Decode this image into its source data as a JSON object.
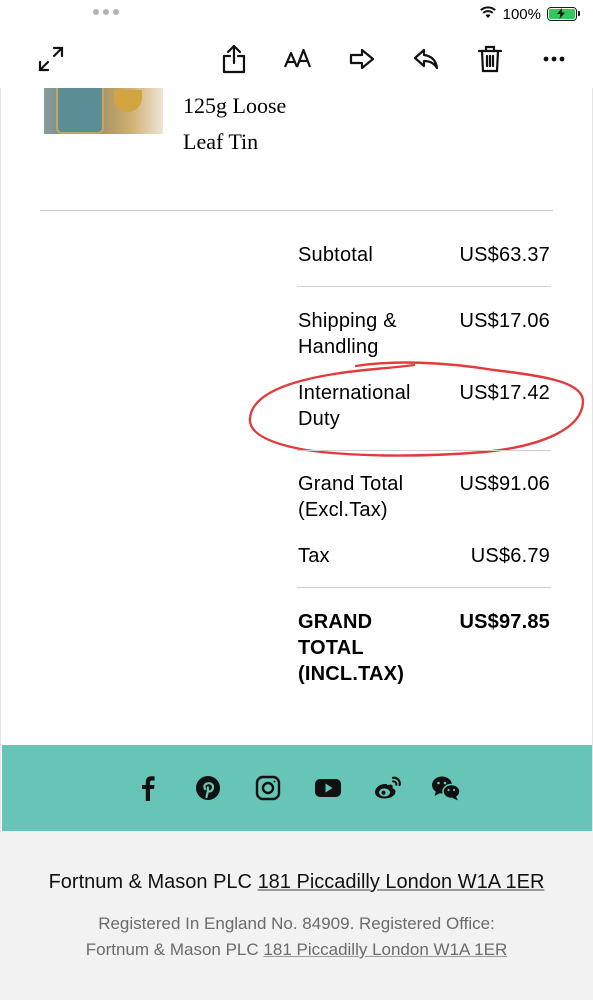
{
  "status_bar": {
    "battery_percent": "100%",
    "battery_color": "#35c759"
  },
  "toolbar": {
    "icons": [
      "expand-icon",
      "share-icon",
      "text-size-icon",
      "forward-icon",
      "reply-icon",
      "trash-icon",
      "more-icon"
    ]
  },
  "product": {
    "name_line1": "125g Loose",
    "name_line2": "Leaf Tin"
  },
  "totals": {
    "subtotal_label": "Subtotal",
    "subtotal_value": "US$63.37",
    "shipping_label": "Shipping &\nHandling",
    "shipping_value": "US$17.06",
    "duty_label": "International\nDuty",
    "duty_value": "US$17.42",
    "grand_excl_label": "Grand Total\n(Excl.Tax)",
    "grand_excl_value": "US$91.06",
    "tax_label": "Tax",
    "tax_value": "US$6.79",
    "grand_incl_label": "GRAND\nTOTAL\n(INCL.TAX)",
    "grand_incl_value": "US$97.85"
  },
  "annotation": {
    "color": "#e23b3b"
  },
  "social": {
    "background": "#67c5b7",
    "icons": [
      "facebook-icon",
      "pinterest-icon",
      "instagram-icon",
      "youtube-icon",
      "weibo-icon",
      "wechat-icon"
    ]
  },
  "footer": {
    "company": "Fortnum & Mason PLC",
    "address": "181 Piccadilly London W1A 1ER",
    "registered_text": "Registered In England No. 84909. Registered Office:",
    "registered_company": "Fortnum & Mason PLC",
    "registered_address": "181 Piccadilly London W1A 1ER"
  }
}
